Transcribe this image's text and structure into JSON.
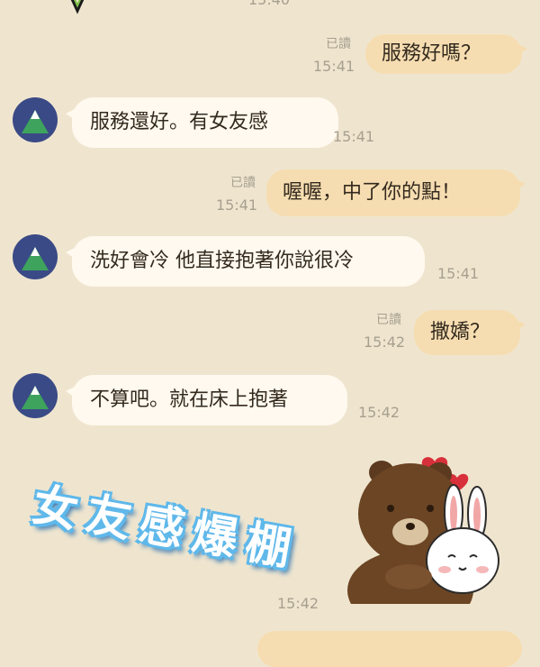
{
  "chat": {
    "messages": [
      {
        "side": "out",
        "text": "服務好嗎？",
        "read": "已讀",
        "time": "15:41"
      },
      {
        "side": "in",
        "text": "服務還好。有女友感",
        "time": "15:41"
      },
      {
        "side": "out",
        "text": "喔喔，中了你的點！",
        "read": "已讀",
        "time": "15:41"
      },
      {
        "side": "in",
        "text": "洗好會冷 他直接抱著你說很冷",
        "time": "15:41"
      },
      {
        "side": "out",
        "text": "撒嬌？",
        "read": "已讀",
        "time": "15:42"
      },
      {
        "side": "in",
        "text": "不算吧。就在床上抱著",
        "time": "15:42"
      }
    ],
    "sticker": {
      "caption": "女友感爆棚",
      "time": "15:42"
    },
    "top_time_partial": "15:40"
  },
  "colors": {
    "background": "#efe5cf",
    "outgoing_bubble": "#f6ddb1",
    "incoming_bubble": "#fff9ef",
    "avatar": "#3a4a86"
  }
}
